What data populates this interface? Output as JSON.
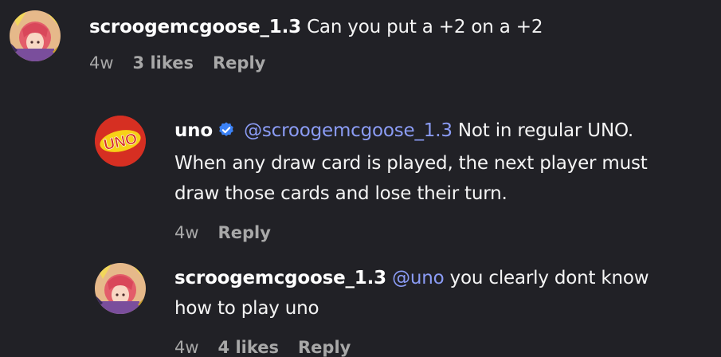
{
  "comments": [
    {
      "username": "scroogemcgoose_1.3",
      "text": "Can you put a +2 on a +2",
      "time": "4w",
      "likes": "3 likes",
      "reply": "Reply"
    },
    {
      "username": "uno",
      "mention": "@scroogemcgoose_1.3",
      "text_line1": "Not in regular UNO.",
      "text_line2": "When any draw card is played, the next player must",
      "text_line3": "draw those cards and lose their turn.",
      "time": "4w",
      "reply": "Reply",
      "logo_text": "UNO",
      "verified": true
    },
    {
      "username": "scroogemcgoose_1.3",
      "mention": "@uno",
      "text_line1": "you clearly dont know",
      "text_line2": "how to play uno",
      "time": "4w",
      "likes": "4 likes",
      "reply": "Reply"
    }
  ],
  "colors": {
    "background": "#212126",
    "mention": "#8b9cf5",
    "meta": "#a8a8a8",
    "verified": "#3b82f6",
    "uno_red": "#d62f22",
    "uno_yellow": "#f7d117"
  },
  "icons": {
    "avatar": "anime-avatar-icon",
    "uno_logo": "uno-logo-icon",
    "verified": "verified-badge-icon"
  }
}
